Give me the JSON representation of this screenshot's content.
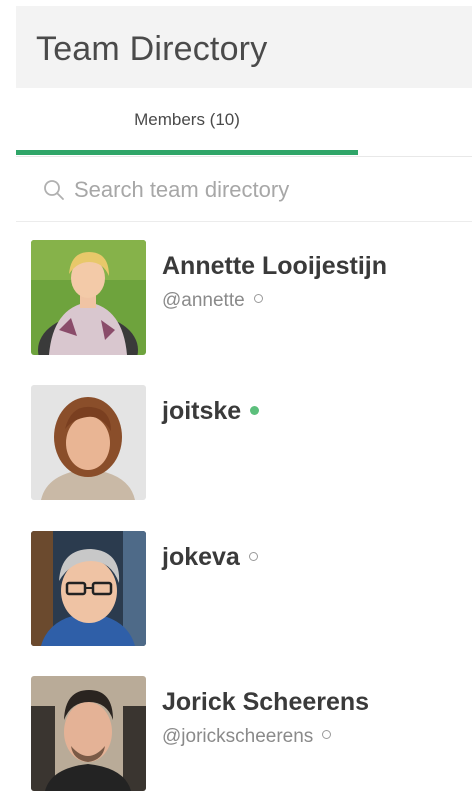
{
  "header": {
    "title": "Team Directory"
  },
  "tabs": [
    {
      "label": "Members (10)",
      "active": true
    }
  ],
  "search": {
    "placeholder": "Search team directory",
    "value": "",
    "icon": "search-icon"
  },
  "members": [
    {
      "name": "Annette Looijestijn",
      "handle": "@annette",
      "status": "offline"
    },
    {
      "name": "joitske",
      "handle": "",
      "status": "online"
    },
    {
      "name": "jokeva",
      "handle": "",
      "status": "offline"
    },
    {
      "name": "Jorick Scheerens",
      "handle": "@jorickscheerens",
      "status": "offline"
    }
  ],
  "colors": {
    "accent": "#2fa568",
    "online": "#5cbf7c",
    "header_bg": "#f3f3f3"
  }
}
